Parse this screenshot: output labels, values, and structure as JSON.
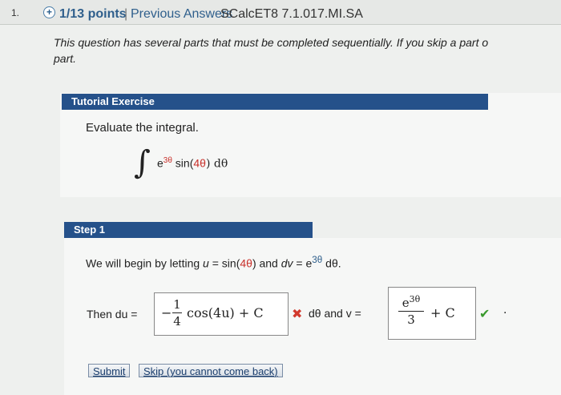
{
  "header": {
    "question_number": "1.",
    "points": "1/13 points",
    "separator": "|",
    "previous_answers": "Previous Answers",
    "course_code": "SCalcET8 7.1.017.MI.SA"
  },
  "intro": {
    "line1": "This question has several parts that must be completed sequentially. If you skip a part o",
    "line2": "part."
  },
  "tutorial": {
    "header": "Tutorial Exercise",
    "prompt": "Evaluate the integral.",
    "integral_sign": "∫",
    "integrand_base": "e",
    "integrand_exp": "3θ",
    "integrand_sin": " sin(",
    "integrand_arg": "4θ",
    "integrand_close": ") dθ"
  },
  "step1": {
    "header": "Step 1",
    "begin_a": "We will begin by letting ",
    "u_var": "u",
    "begin_b": " = sin(",
    "begin_arg": "4θ",
    "begin_c": ")  and  ",
    "dv_var": "dv",
    "begin_d": " = e",
    "begin_exp": "3θ",
    "begin_e": " dθ.",
    "then_label": "Then du =",
    "du_sign": "−",
    "du_num": "1",
    "du_den": "4",
    "du_rest": "cos(4u) + C",
    "du_status_icon": "cross-icon",
    "dtheta_and_v": "dθ  and  v =",
    "v_num_base": "e",
    "v_num_exp": "3θ",
    "v_den": "3",
    "v_rest": "+ C",
    "v_status_icon": "check-icon",
    "trailing_dot": "."
  },
  "buttons": {
    "submit": "Submit",
    "skip": "Skip (you cannot come back)"
  },
  "colors": {
    "header_blue": "#25518a",
    "wrong_red": "#d23a2e",
    "correct_green": "#3a9a2e",
    "link_blue": "#2f5f8c"
  }
}
